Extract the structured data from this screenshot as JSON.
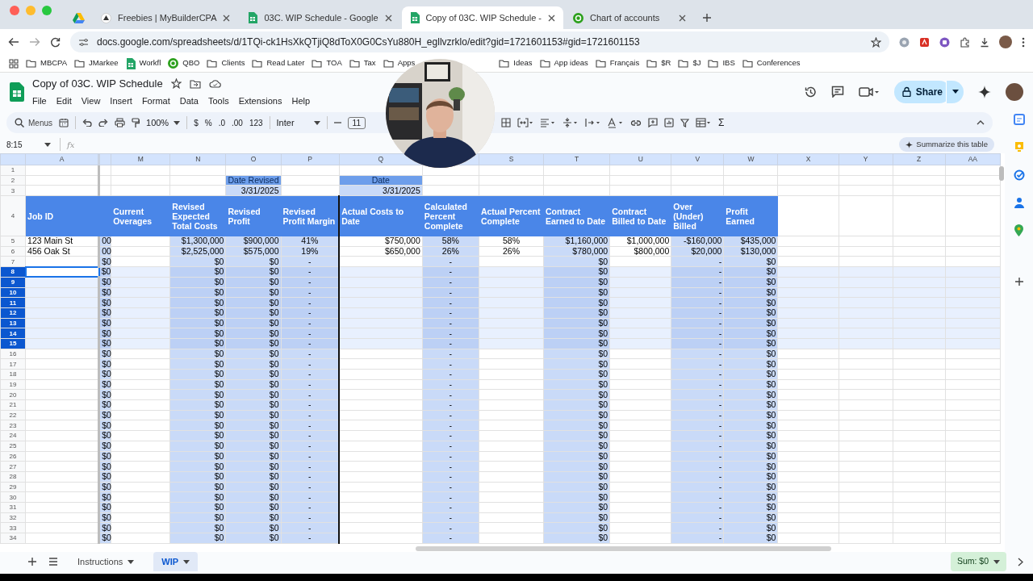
{
  "browser": {
    "tabs": [
      {
        "kind": "pinned",
        "selected": false
      },
      {
        "kind": "site",
        "title": "Freebies | MyBuilderCPA",
        "selected": false
      },
      {
        "kind": "sheets",
        "title": "03C. WIP Schedule - Google",
        "selected": false
      },
      {
        "kind": "sheets",
        "title": "Copy of 03C. WIP Schedule -",
        "selected": true
      },
      {
        "kind": "qbo",
        "title": "Chart of accounts",
        "selected": false
      }
    ],
    "url": "docs.google.com/spreadsheets/d/1TQi-ck1HsXkQTjiQ8dToX0G0CsYu880H_egllvzrklo/edit?gid=1721601153#gid=1721601153",
    "bookmarks": [
      {
        "kind": "folder",
        "label": "MBCPA"
      },
      {
        "kind": "folder",
        "label": "JMarkee"
      },
      {
        "kind": "sheets",
        "label": "Workfl"
      },
      {
        "kind": "qbo",
        "label": "QBO"
      },
      {
        "kind": "folder",
        "label": "Clients"
      },
      {
        "kind": "folder",
        "label": "Read Later"
      },
      {
        "kind": "folder",
        "label": "TOA"
      },
      {
        "kind": "folder",
        "label": "Tax"
      },
      {
        "kind": "folder",
        "label": "Apps"
      },
      {
        "kind": "folder",
        "label": "Ideas"
      },
      {
        "kind": "folder",
        "label": "App ideas"
      },
      {
        "kind": "folder",
        "label": "Français"
      },
      {
        "kind": "folder",
        "label": "$R"
      },
      {
        "kind": "folder",
        "label": "$J"
      },
      {
        "kind": "folder",
        "label": "IBS"
      },
      {
        "kind": "folder",
        "label": "Conferences"
      }
    ]
  },
  "doc": {
    "title": "Copy of 03C. WIP Schedule",
    "menus": [
      "File",
      "Edit",
      "View",
      "Insert",
      "Format",
      "Data",
      "Tools",
      "Extensions",
      "Help"
    ],
    "share": "Share"
  },
  "toolbar": {
    "search": "Menus",
    "zoom": "100%",
    "number_formats": [
      "$",
      "%",
      ".0",
      ".00",
      "123"
    ],
    "font": "Inter",
    "font_size": "11",
    "functions": "Σ"
  },
  "formula_bar": {
    "cell_ref": "8:15",
    "fx": "fx",
    "summarize": "Summarize this table"
  },
  "sheet": {
    "columns": [
      {
        "letter": "A",
        "kind": "text"
      },
      {
        "kind": "text",
        "shaded": true
      },
      {
        "letter": "M",
        "kind": "text"
      },
      {
        "letter": "N",
        "kind": "money",
        "shaded": true
      },
      {
        "letter": "O",
        "kind": "money",
        "shaded": true
      },
      {
        "letter": "P",
        "kind": "percent",
        "shaded": true,
        "rule_after": true
      },
      {
        "letter": "Q",
        "kind": "money"
      },
      {
        "kind": "percent",
        "shaded": true
      },
      {
        "letter": "S",
        "kind": "percent"
      },
      {
        "letter": "T",
        "kind": "money",
        "shaded": true
      },
      {
        "letter": "U",
        "kind": "money"
      },
      {
        "letter": "V",
        "kind": "money",
        "shaded": true
      },
      {
        "letter": "W",
        "kind": "money",
        "shaded": true
      },
      {
        "letter": "X"
      },
      {
        "letter": "Y"
      },
      {
        "letter": "Z"
      },
      {
        "letter": "AA"
      }
    ],
    "rows": [
      {
        "number": "1",
        "kind": "blank",
        "selected": false,
        "active": false
      },
      {
        "number": "2",
        "kind": "title",
        "selected": false,
        "active": false,
        "cells": [
          null,
          null,
          null,
          null,
          "Date Revised",
          null,
          "Date"
        ]
      },
      {
        "number": "3",
        "kind": "date",
        "selected": false,
        "active": false,
        "cells": [
          null,
          null,
          null,
          null,
          "3/31/2025",
          null,
          "3/31/2025"
        ]
      },
      {
        "number": "4",
        "kind": "header",
        "selected": false,
        "active": false,
        "cells": [
          "Job ID",
          null,
          "Current Overages",
          "Revised Expected Total Costs",
          "Revised Profit",
          "Revised Profit Margin",
          "Actual Costs to Date",
          "Calculated Percent Complete",
          "Actual Percent Complete",
          "Contract Earned to Date",
          "Contract Billed to Date",
          "Over (Under) Billed",
          "Profit Earned"
        ]
      },
      {
        "number": "5",
        "kind": "data",
        "selected": false,
        "active": false,
        "cells": [
          "123 Main St",
          "00",
          null,
          "$1,300,000",
          "$900,000",
          "41%",
          "$750,000",
          "58%",
          "58%",
          "$1,160,000",
          "$1,000,000",
          "-$160,000",
          "$435,000"
        ]
      },
      {
        "number": "6",
        "kind": "data",
        "selected": false,
        "active": false,
        "cells": [
          "456 Oak St",
          "00",
          null,
          "$2,525,000",
          "$575,000",
          "19%",
          "$650,000",
          "26%",
          "26%",
          "$780,000",
          "$800,000",
          "$20,000",
          "$130,000"
        ]
      },
      {
        "number": "7",
        "kind": "data",
        "selected": false,
        "active": false,
        "cells": [
          null,
          "$0",
          null,
          "$0",
          "$0",
          "-",
          null,
          "-",
          null,
          "$0",
          null,
          "-",
          "$0"
        ]
      },
      {
        "number": "8",
        "kind": "data",
        "selected": true,
        "active": true,
        "cells": [
          null,
          "$0",
          null,
          "$0",
          "$0",
          "-",
          null,
          "-",
          null,
          "$0",
          null,
          "-",
          "$0"
        ]
      },
      {
        "number": "9",
        "kind": "data",
        "selected": true,
        "active": false,
        "cells": [
          null,
          "$0",
          null,
          "$0",
          "$0",
          "-",
          null,
          "-",
          null,
          "$0",
          null,
          "-",
          "$0"
        ]
      },
      {
        "number": "10",
        "kind": "data",
        "selected": true,
        "active": false,
        "cells": [
          null,
          "$0",
          null,
          "$0",
          "$0",
          "-",
          null,
          "-",
          null,
          "$0",
          null,
          "-",
          "$0"
        ]
      },
      {
        "number": "11",
        "kind": "data",
        "selected": true,
        "active": false,
        "cells": [
          null,
          "$0",
          null,
          "$0",
          "$0",
          "-",
          null,
          "-",
          null,
          "$0",
          null,
          "-",
          "$0"
        ]
      },
      {
        "number": "12",
        "kind": "data",
        "selected": true,
        "active": false,
        "cells": [
          null,
          "$0",
          null,
          "$0",
          "$0",
          "-",
          null,
          "-",
          null,
          "$0",
          null,
          "-",
          "$0"
        ]
      },
      {
        "number": "13",
        "kind": "data",
        "selected": true,
        "active": false,
        "cells": [
          null,
          "$0",
          null,
          "$0",
          "$0",
          "-",
          null,
          "-",
          null,
          "$0",
          null,
          "-",
          "$0"
        ]
      },
      {
        "number": "14",
        "kind": "data",
        "selected": true,
        "active": false,
        "cells": [
          null,
          "$0",
          null,
          "$0",
          "$0",
          "-",
          null,
          "-",
          null,
          "$0",
          null,
          "-",
          "$0"
        ]
      },
      {
        "number": "15",
        "kind": "data",
        "selected": true,
        "active": false,
        "cells": [
          null,
          "$0",
          null,
          "$0",
          "$0",
          "-",
          null,
          "-",
          null,
          "$0",
          null,
          "-",
          "$0"
        ]
      },
      {
        "number": "16",
        "kind": "data",
        "selected": false,
        "active": false,
        "cells": [
          null,
          "$0",
          null,
          "$0",
          "$0",
          "-",
          null,
          "-",
          null,
          "$0",
          null,
          "-",
          "$0"
        ]
      },
      {
        "number": "17",
        "kind": "data",
        "selected": false,
        "active": false,
        "cells": [
          null,
          "$0",
          null,
          "$0",
          "$0",
          "-",
          null,
          "-",
          null,
          "$0",
          null,
          "-",
          "$0"
        ]
      },
      {
        "number": "18",
        "kind": "data",
        "selected": false,
        "active": false,
        "cells": [
          null,
          "$0",
          null,
          "$0",
          "$0",
          "-",
          null,
          "-",
          null,
          "$0",
          null,
          "-",
          "$0"
        ]
      },
      {
        "number": "19",
        "kind": "data",
        "selected": false,
        "active": false,
        "cells": [
          null,
          "$0",
          null,
          "$0",
          "$0",
          "-",
          null,
          "-",
          null,
          "$0",
          null,
          "-",
          "$0"
        ]
      },
      {
        "number": "20",
        "kind": "data",
        "selected": false,
        "active": false,
        "cells": [
          null,
          "$0",
          null,
          "$0",
          "$0",
          "-",
          null,
          "-",
          null,
          "$0",
          null,
          "-",
          "$0"
        ]
      },
      {
        "number": "21",
        "kind": "data",
        "selected": false,
        "active": false,
        "cells": [
          null,
          "$0",
          null,
          "$0",
          "$0",
          "-",
          null,
          "-",
          null,
          "$0",
          null,
          "-",
          "$0"
        ]
      },
      {
        "number": "22",
        "kind": "data",
        "selected": false,
        "active": false,
        "cells": [
          null,
          "$0",
          null,
          "$0",
          "$0",
          "-",
          null,
          "-",
          null,
          "$0",
          null,
          "-",
          "$0"
        ]
      },
      {
        "number": "23",
        "kind": "data",
        "selected": false,
        "active": false,
        "cells": [
          null,
          "$0",
          null,
          "$0",
          "$0",
          "-",
          null,
          "-",
          null,
          "$0",
          null,
          "-",
          "$0"
        ]
      },
      {
        "number": "24",
        "kind": "data",
        "selected": false,
        "active": false,
        "cells": [
          null,
          "$0",
          null,
          "$0",
          "$0",
          "-",
          null,
          "-",
          null,
          "$0",
          null,
          "-",
          "$0"
        ]
      },
      {
        "number": "25",
        "kind": "data",
        "selected": false,
        "active": false,
        "cells": [
          null,
          "$0",
          null,
          "$0",
          "$0",
          "-",
          null,
          "-",
          null,
          "$0",
          null,
          "-",
          "$0"
        ]
      },
      {
        "number": "26",
        "kind": "data",
        "selected": false,
        "active": false,
        "cells": [
          null,
          "$0",
          null,
          "$0",
          "$0",
          "-",
          null,
          "-",
          null,
          "$0",
          null,
          "-",
          "$0"
        ]
      },
      {
        "number": "27",
        "kind": "data",
        "selected": false,
        "active": false,
        "cells": [
          null,
          "$0",
          null,
          "$0",
          "$0",
          "-",
          null,
          "-",
          null,
          "$0",
          null,
          "-",
          "$0"
        ]
      },
      {
        "number": "28",
        "kind": "data",
        "selected": false,
        "active": false,
        "cells": [
          null,
          "$0",
          null,
          "$0",
          "$0",
          "-",
          null,
          "-",
          null,
          "$0",
          null,
          "-",
          "$0"
        ]
      },
      {
        "number": "29",
        "kind": "data",
        "selected": false,
        "active": false,
        "cells": [
          null,
          "$0",
          null,
          "$0",
          "$0",
          "-",
          null,
          "-",
          null,
          "$0",
          null,
          "-",
          "$0"
        ]
      },
      {
        "number": "30",
        "kind": "data",
        "selected": false,
        "active": false,
        "cells": [
          null,
          "$0",
          null,
          "$0",
          "$0",
          "-",
          null,
          "-",
          null,
          "$0",
          null,
          "-",
          "$0"
        ]
      },
      {
        "number": "31",
        "kind": "data",
        "selected": false,
        "active": false,
        "cells": [
          null,
          "$0",
          null,
          "$0",
          "$0",
          "-",
          null,
          "-",
          null,
          "$0",
          null,
          "-",
          "$0"
        ]
      },
      {
        "number": "32",
        "kind": "data",
        "selected": false,
        "active": false,
        "cells": [
          null,
          "$0",
          null,
          "$0",
          "$0",
          "-",
          null,
          "-",
          null,
          "$0",
          null,
          "-",
          "$0"
        ]
      },
      {
        "number": "33",
        "kind": "data",
        "selected": false,
        "active": false,
        "cells": [
          null,
          "$0",
          null,
          "$0",
          "$0",
          "-",
          null,
          "-",
          null,
          "$0",
          null,
          "-",
          "$0"
        ]
      },
      {
        "number": "34",
        "kind": "data",
        "selected": false,
        "active": false,
        "cells": [
          null,
          "$0",
          null,
          "$0",
          "$0",
          "-",
          null,
          "-",
          null,
          "$0",
          null,
          "-",
          "$0"
        ]
      }
    ]
  },
  "sheet_tabs": [
    {
      "label": "Instructions",
      "selected": false
    },
    {
      "label": "WIP",
      "selected": true
    }
  ],
  "sum": "Sum: $0"
}
